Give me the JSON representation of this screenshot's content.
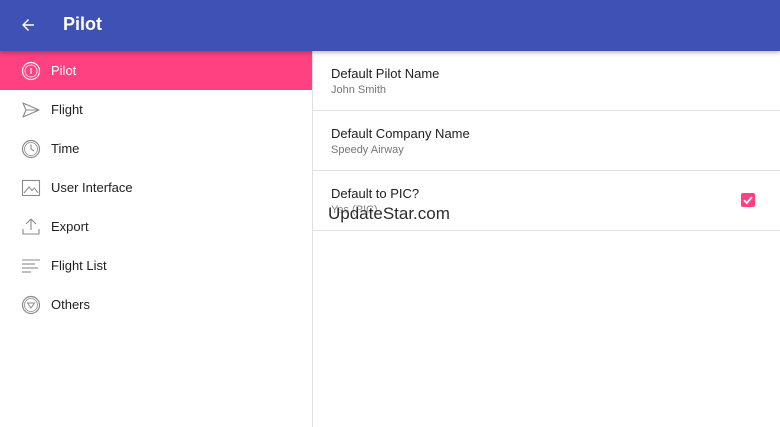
{
  "header": {
    "title": "Pilot",
    "back_icon": "arrow-left-icon",
    "background_color": "#3f51b5"
  },
  "sidebar": {
    "accent_color": "#ff4081",
    "items": [
      {
        "label": "Pilot",
        "icon": "info-circle-icon",
        "active": true
      },
      {
        "label": "Flight",
        "icon": "paper-plane-icon",
        "active": false
      },
      {
        "label": "Time",
        "icon": "clock-icon",
        "active": false
      },
      {
        "label": "User Interface",
        "icon": "image-frame-icon",
        "active": false
      },
      {
        "label": "Export",
        "icon": "upload-icon",
        "active": false
      },
      {
        "label": "Flight List",
        "icon": "list-lines-icon",
        "active": false
      },
      {
        "label": "Others",
        "icon": "shield-circle-icon",
        "active": false
      }
    ]
  },
  "settings": {
    "items": [
      {
        "title": "Default Pilot Name",
        "summary": "John Smith"
      },
      {
        "title": "Default Company Name",
        "summary": "Speedy Airway"
      },
      {
        "title": "Default to PIC?",
        "summary": "Yes (PIC)",
        "checked": true
      }
    ]
  },
  "watermark": "UpdateStar.com"
}
